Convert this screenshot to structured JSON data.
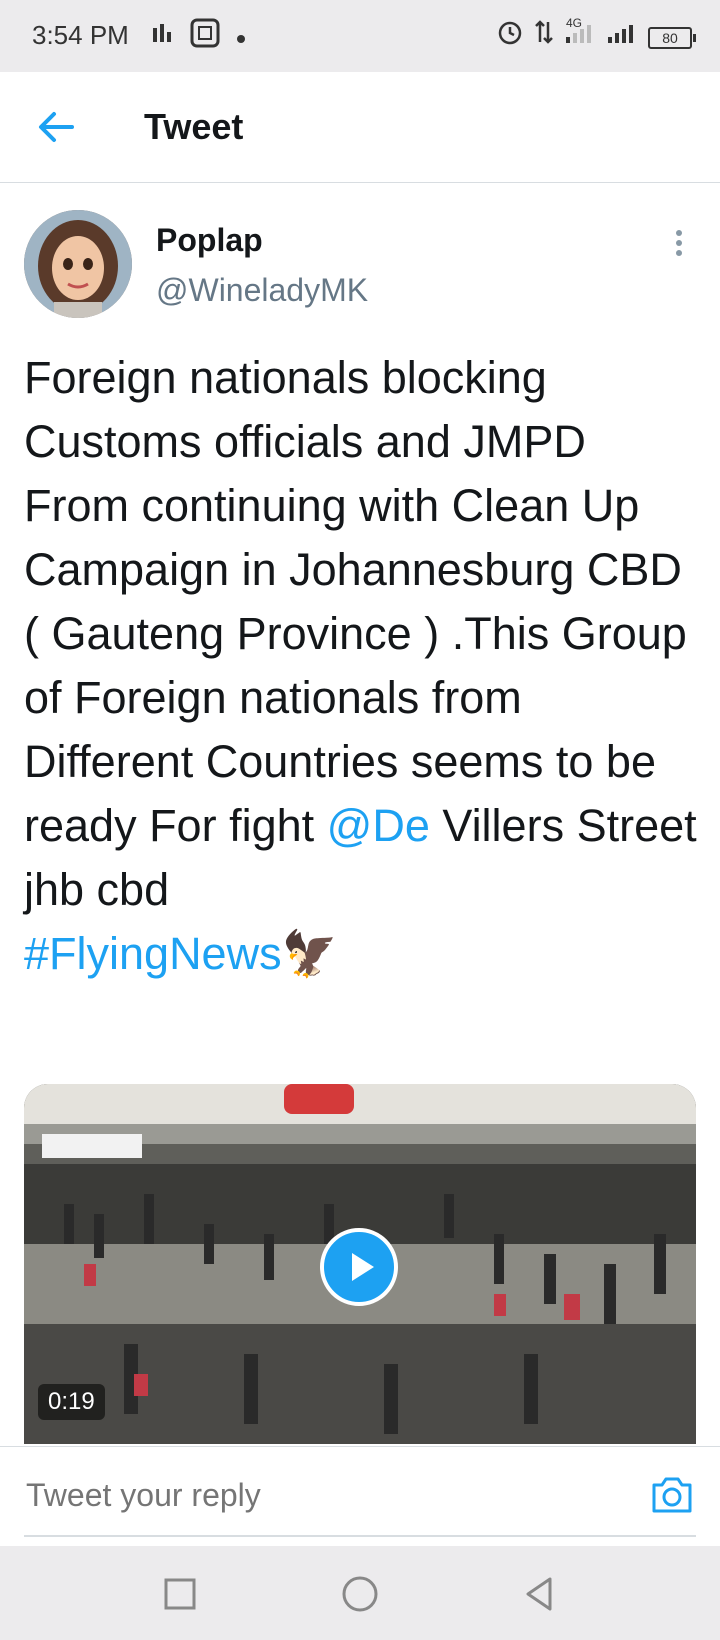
{
  "status_bar": {
    "time": "3:54 PM",
    "network_label": "4G",
    "battery": "80",
    "icons": [
      "data-transfer-icon",
      "sim-icon",
      "dot-icon",
      "alarm-icon",
      "data-arrows-icon",
      "signal-icon",
      "signal-icon-2",
      "battery-icon"
    ]
  },
  "header": {
    "title": "Tweet",
    "back_icon": "arrow-left-icon"
  },
  "tweet": {
    "display_name": "Poplap",
    "handle": "@WineladyMK",
    "text_parts": {
      "body": "Foreign nationals blocking Customs officials and JMPD From continuing with Clean Up Campaign in Johannesburg CBD ( Gauteng Province ) .This Group of Foreign nationals from Different Countries seems to be ready For fight ",
      "mention": "@De",
      "after_mention": " Villers Street jhb cbd",
      "hashtag": "#FlyingNews",
      "emoji": "🦅"
    },
    "media": {
      "duration": "0:19"
    }
  },
  "reply": {
    "placeholder": "Tweet your reply"
  },
  "colors": {
    "accent": "#1da1f2",
    "secondary_text": "#657786",
    "bars": "#ecebed"
  }
}
